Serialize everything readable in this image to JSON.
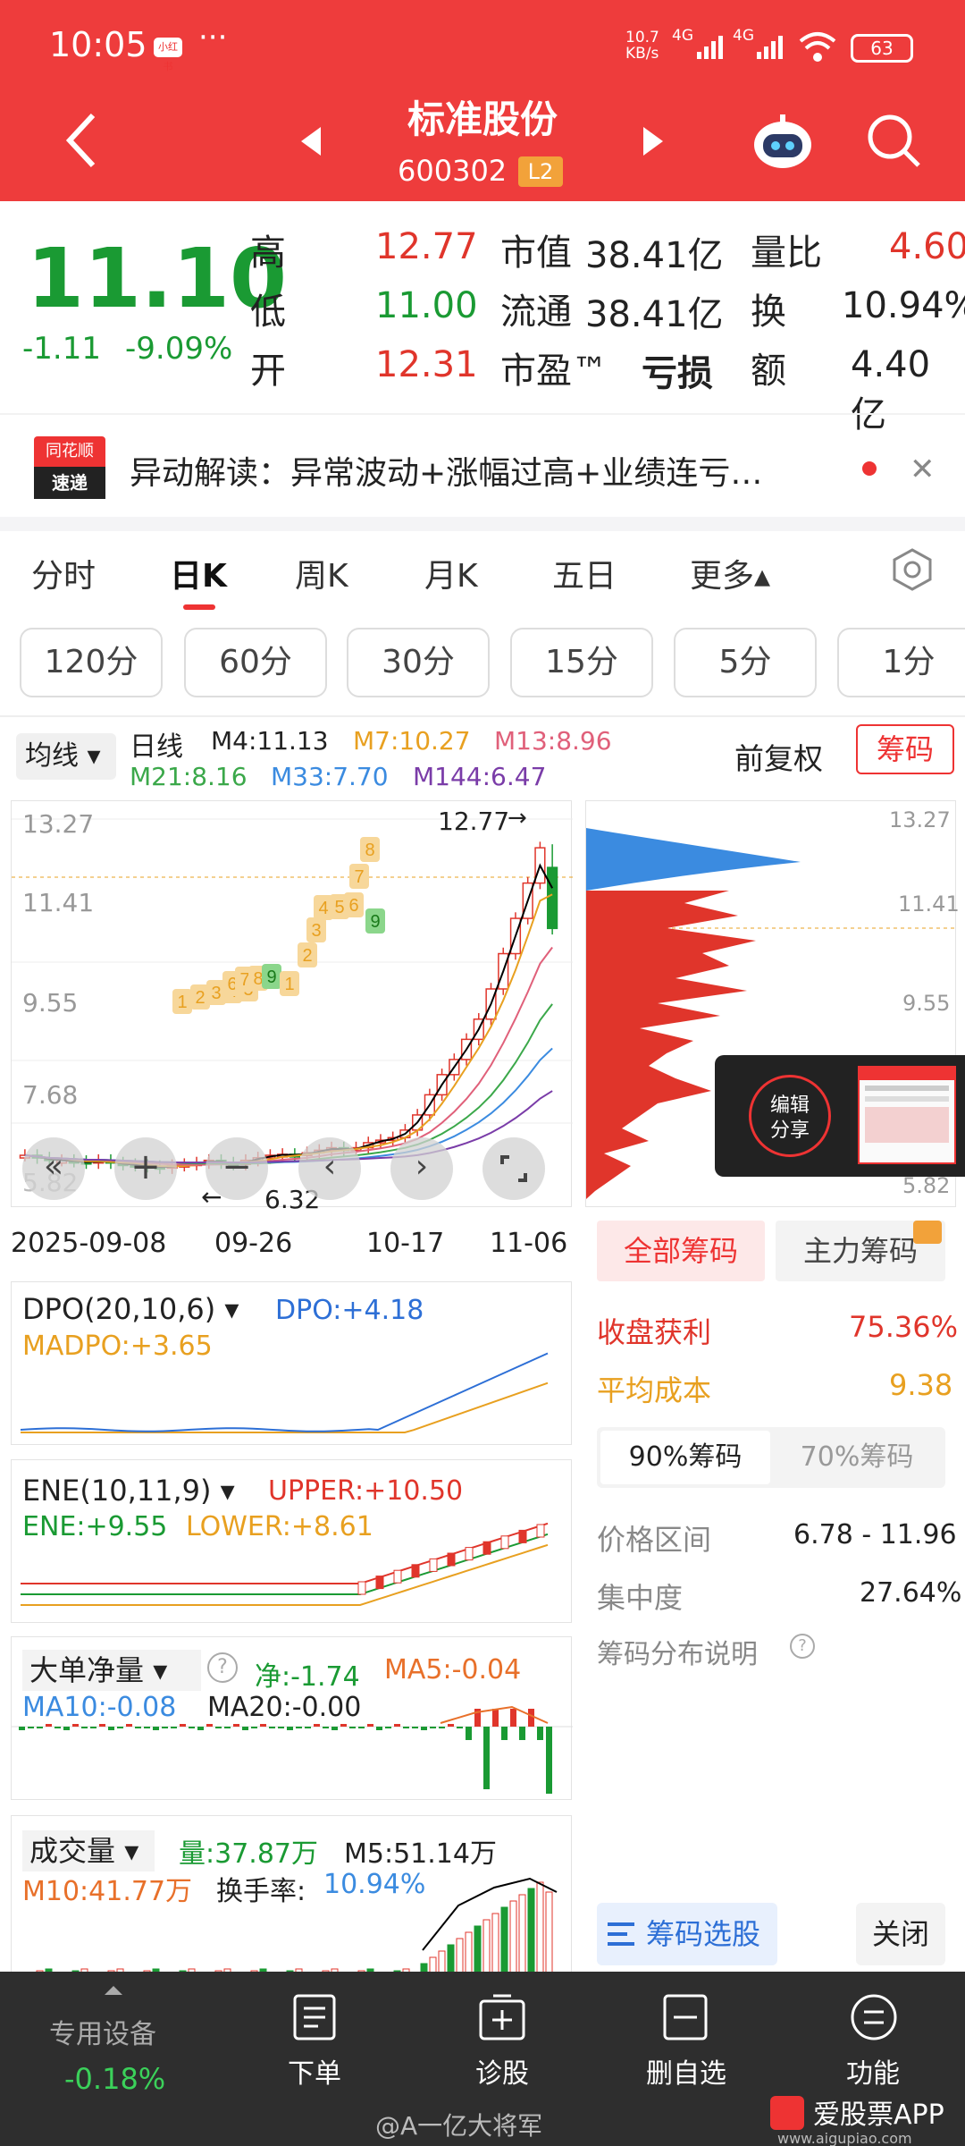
{
  "status": {
    "time": "10:05",
    "net": "10.7\nKB/s",
    "sig1": "4G",
    "sig2": "4G",
    "battery": "63",
    "dots": "···",
    "app_badge": "小红书"
  },
  "header": {
    "title": "标准股份",
    "code": "600302",
    "level": "L2"
  },
  "quote": {
    "price": "11.10",
    "change": "-1.11",
    "pct": "-9.09%",
    "rows": [
      {
        "k": "高",
        "v": "12.77",
        "k2": "市值",
        "v2": "38.41亿",
        "k3": "量比",
        "v3": "4.60"
      },
      {
        "k": "低",
        "v": "11.00",
        "k2": "流通",
        "v2": "38.41亿",
        "k3": "换",
        "v3": "10.94%"
      },
      {
        "k": "开",
        "v": "12.31",
        "k2": "市盈™",
        "v2": "亏损",
        "k3": "额",
        "v3": "4.40亿"
      }
    ]
  },
  "news": {
    "logo1": "同花顺",
    "logo2": "速递",
    "text": "异动解读：异常波动+涨幅过高+业绩连亏…"
  },
  "tabs": [
    "分时",
    "日K",
    "周K",
    "月K",
    "五日",
    "更多▴"
  ],
  "intervals": [
    "120分",
    "60分",
    "30分",
    "15分",
    "5分",
    "1分"
  ],
  "ma": {
    "sel": "均线",
    "line": "日线",
    "m4": "M4:11.13",
    "m7": "M7:10.27",
    "m13": "M13:8.96",
    "m21": "M21:8.16",
    "m33": "M33:7.70",
    "m144": "M144:6.47",
    "fq": "前复权",
    "chip": "筹码"
  },
  "kchart": {
    "yticks": [
      "13.27",
      "11.41",
      "9.55",
      "7.68",
      "5.82"
    ],
    "high_label": "12.77",
    "low_label": "6.32",
    "dates": [
      "2025-09-08",
      "09-26",
      "10-17",
      "11-06"
    ],
    "nine_counts": [
      "1",
      "2",
      "3",
      "4",
      "5",
      "6",
      "7",
      "8",
      "9",
      "1",
      "2",
      "3",
      "4",
      "5",
      "6",
      "7",
      "8",
      "9"
    ]
  },
  "chip_axis": [
    "13.27",
    "11.41",
    "9.55",
    "5.82"
  ],
  "edit": {
    "a": "编辑",
    "b": "分享"
  },
  "chip_panel": {
    "tab1": "全部筹码",
    "tab2": "主力筹码",
    "profit_k": "收盘获利",
    "profit_v": "75.36%",
    "cost_k": "平均成本",
    "cost_v": "9.38",
    "s1": "90%筹码",
    "s2": "70%筹码",
    "range_k": "价格区间",
    "range_v": "6.78 - 11.96",
    "conc_k": "集中度",
    "conc_v": "27.64%",
    "desc": "筹码分布说明",
    "select": "筹码选股",
    "close": "关闭"
  },
  "dpo": {
    "name": "DPO(20,10,6)",
    "v": "DPO:+4.18",
    "ma": "MADPO:+3.65"
  },
  "ene": {
    "name": "ENE(10,11,9)",
    "up": "UPPER:+10.50",
    "ene": "ENE:+9.55",
    "low": "LOWER:+8.61"
  },
  "big": {
    "name": "大单净量",
    "net": "净:-1.74",
    "ma5": "MA5:-0.04",
    "ma10": "MA10:-0.08",
    "ma20": "MA20:-0.00"
  },
  "vol": {
    "name": "成交量",
    "v": "量:37.87万",
    "m5": "M5:51.14万",
    "m10": "M10:41.77万",
    "hs": "换手率:",
    "hsv": "10.94%"
  },
  "nav": {
    "dev": "专用设备",
    "devv": "-0.18%",
    "items": [
      "下单",
      "诊股",
      "删自选",
      "功能"
    ]
  },
  "watermark": {
    "w": "@A一亿大将军",
    "app": "爱股票APP",
    "site": "www.aigupiao.com"
  },
  "colors": {
    "red": "#e0352b",
    "green": "#1a9a33",
    "header": "#ee3c3c",
    "blue": "#3b8be0",
    "orange": "#e8a020"
  }
}
